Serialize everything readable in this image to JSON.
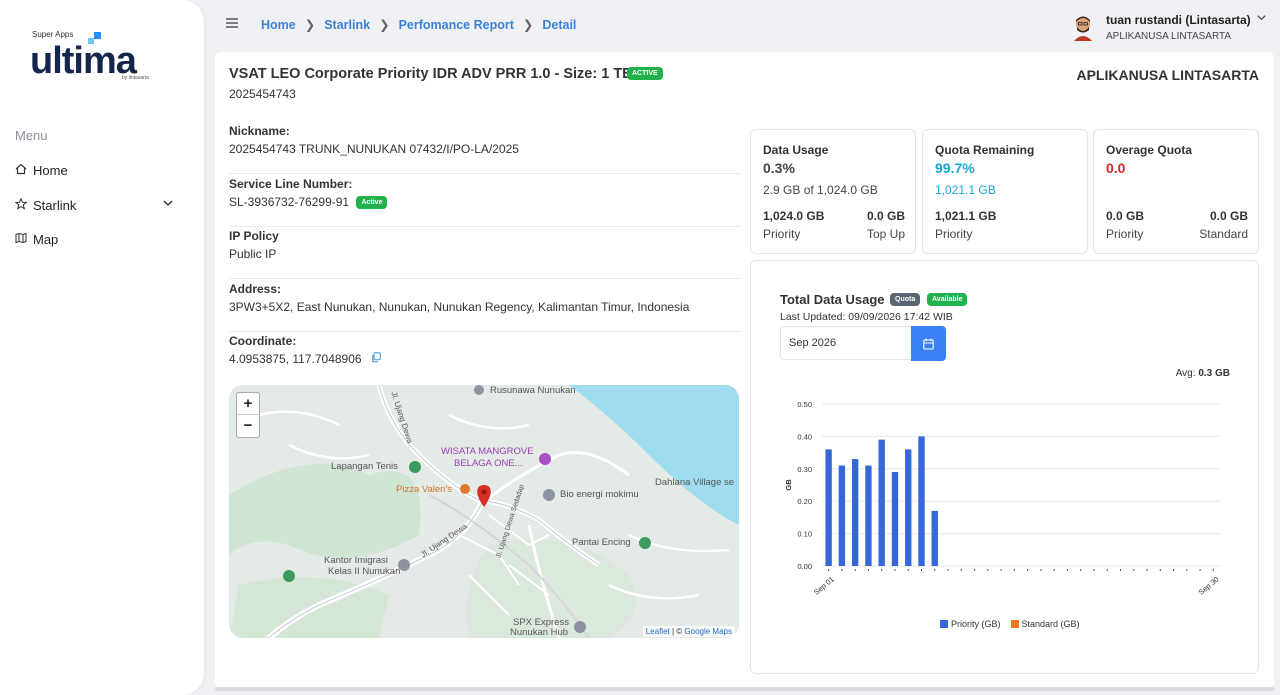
{
  "sidebar": {
    "logo": {
      "super_apps": "Super Apps",
      "word": "ultima",
      "by": "by lintasarta"
    },
    "menu_title": "Menu",
    "items": [
      {
        "label": "Home",
        "icon": "home-icon"
      },
      {
        "label": "Starlink",
        "icon": "star-icon"
      },
      {
        "label": "Map",
        "icon": "map-icon"
      }
    ]
  },
  "header": {
    "breadcrumb": [
      "Home",
      "Starlink",
      "Perfomance Report",
      "Detail"
    ],
    "user_name": "tuan rustandi (Lintasarta)",
    "user_org": "APLIKANUSA LINTASARTA"
  },
  "detail": {
    "title": "VSAT LEO Corporate Priority IDR ADV PRR 1.0 - Size: 1 TB",
    "status_badge": "ACTIVE",
    "account_number": "2025454743",
    "company": "APLIKANUSA LINTASARTA",
    "fields": {
      "nickname_label": "Nickname:",
      "nickname_value": "2025454743 TRUNK_NUNUKAN 07432/I/PO-LA/2025",
      "service_line_label": "Service Line Number:",
      "service_line_value": "SL-3936732-76299-91",
      "service_line_badge": "Active",
      "ip_policy_label": "IP Policy",
      "ip_policy_value": "Public IP",
      "address_label": "Address:",
      "address_value": "3PW3+5X2, East Nunukan, Nunukan, Nunukan Regency, Kalimantan Timur, Indonesia",
      "coordinate_label": "Coordinate:",
      "coordinate_value": "4.0953875, 117.7048906"
    }
  },
  "map": {
    "zoom_in": "+",
    "zoom_out": "−",
    "pois": {
      "rusunawa": "Rusunawa Nunukan",
      "lapangan": "Lapangan Tenis",
      "wisata": "WISATA MANGROVE",
      "wisata2": "BELAGA ONE...",
      "pizza": "Pizza Valen's",
      "bio": "Bio energi mokimu",
      "dahlana": "Dahlana Village se",
      "pantai": "Pantai Encing",
      "kantor": "Kantor Imigrasi",
      "kantor2": "Kelas II Nunukan",
      "spx": "SPX Express",
      "spx2": "Nunukan Hub",
      "road1": "Jl. Ujang Dewa",
      "road2": "Jl. Ujang Dewa Sedadap",
      "road3": "Jl. Ujang Dewa"
    },
    "attribution_leaflet": "Leaflet",
    "attribution_sep": " | © ",
    "attribution_google": "Google Maps"
  },
  "stats": {
    "data_usage": {
      "title": "Data Usage",
      "percent": "0.3%",
      "detail": "2.9 GB of 1,024.0 GB",
      "v1": "1,024.0 GB",
      "l1": "Priority",
      "v2": "0.0 GB",
      "l2": "Top Up"
    },
    "quota_remaining": {
      "title": "Quota Remaining",
      "percent": "99.7%",
      "detail": "1,021.1 GB",
      "v1": "1,021.1 GB",
      "l1": "Priority"
    },
    "overage": {
      "title": "Overage Quota",
      "value": "0.0",
      "v1": "0.0 GB",
      "l1": "Priority",
      "v2": "0.0 GB",
      "l2": "Standard"
    }
  },
  "colors": {
    "accent": "#3b82d6",
    "quota_cyan": "#1aa3d1",
    "overage_red": "#d6262c",
    "active_green": "#22b14c",
    "priority_bar": "#3567d6",
    "standard_bar": "#f07b22"
  },
  "usage_chart": {
    "title": "Total Data Usage",
    "badge_quota": "Quota",
    "badge_available": "Available",
    "last_updated": "Last Updated: 09/09/2026 17:42 WIB",
    "month": "Sep 2026",
    "avg_label": "Avg:",
    "avg_value": "0.3 GB"
  },
  "chart_data": {
    "type": "bar",
    "ylabel": "GB",
    "ylim": [
      0,
      0.5
    ],
    "y_ticks": [
      "0.00",
      "0.10",
      "0.20",
      "0.30",
      "0.40",
      "0.50"
    ],
    "x_tick_labels": [
      "Sep 01",
      "Sep 30"
    ],
    "categories": [
      "Sep 01",
      "Sep 02",
      "Sep 03",
      "Sep 04",
      "Sep 05",
      "Sep 06",
      "Sep 07",
      "Sep 08",
      "Sep 09",
      "Sep 10",
      "Sep 11",
      "Sep 12",
      "Sep 13",
      "Sep 14",
      "Sep 15",
      "Sep 16",
      "Sep 17",
      "Sep 18",
      "Sep 19",
      "Sep 20",
      "Sep 21",
      "Sep 22",
      "Sep 23",
      "Sep 24",
      "Sep 25",
      "Sep 26",
      "Sep 27",
      "Sep 28",
      "Sep 29",
      "Sep 30"
    ],
    "series": [
      {
        "name": "Priority (GB)",
        "color": "#3567d6",
        "values": [
          0.36,
          0.31,
          0.33,
          0.31,
          0.39,
          0.29,
          0.36,
          0.4,
          0.17,
          0,
          0,
          0,
          0,
          0,
          0,
          0,
          0,
          0,
          0,
          0,
          0,
          0,
          0,
          0,
          0,
          0,
          0,
          0,
          0,
          0
        ]
      },
      {
        "name": "Standard (GB)",
        "color": "#f07b22",
        "values": [
          0,
          0,
          0,
          0,
          0,
          0,
          0,
          0,
          0,
          0,
          0,
          0,
          0,
          0,
          0,
          0,
          0,
          0,
          0,
          0,
          0,
          0,
          0,
          0,
          0,
          0,
          0,
          0,
          0,
          0
        ]
      }
    ],
    "legend_position": "bottom",
    "grid": true
  }
}
